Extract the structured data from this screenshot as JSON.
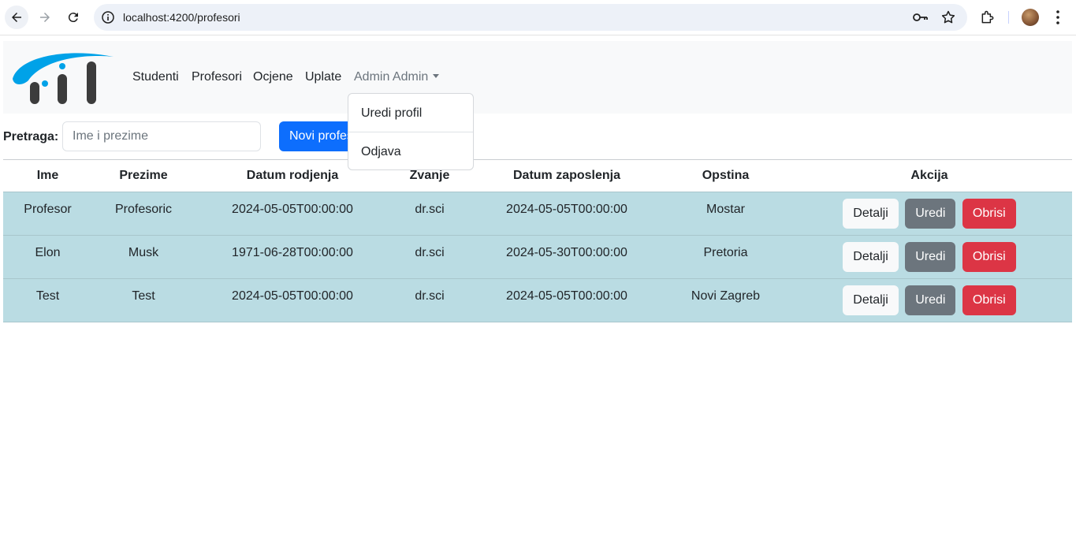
{
  "browser": {
    "url": "localhost:4200/profesori",
    "icons": [
      "back-arrow-icon",
      "forward-arrow-icon",
      "reload-icon",
      "site-info-icon",
      "password-key-icon",
      "bookmark-star-icon",
      "extensions-puzzle-icon",
      "profile-avatar",
      "menu-kebab-icon"
    ]
  },
  "navbar": {
    "items": [
      {
        "label": "Studenti"
      },
      {
        "label": "Profesori"
      },
      {
        "label": "Ocjene"
      },
      {
        "label": "Uplate"
      }
    ],
    "user_label": "Admin Admin",
    "dropdown": {
      "items": [
        {
          "label": "Uredi profil"
        },
        {
          "label": "Odjava"
        }
      ]
    }
  },
  "search": {
    "label": "Pretraga:",
    "placeholder": "Ime i prezime",
    "value": "",
    "new_button_label": "Novi profesor"
  },
  "table": {
    "headers": [
      "Ime",
      "Prezime",
      "Datum rodjenja",
      "Zvanje",
      "Datum zaposlenja",
      "Opstina",
      "Akcija"
    ],
    "rows": [
      {
        "ime": "Profesor",
        "prezime": "Profesoric",
        "datum_rodjenja": "2024-05-05T00:00:00",
        "zvanje": "dr.sci",
        "datum_zaposlenja": "2024-05-05T00:00:00",
        "opstina": "Mostar"
      },
      {
        "ime": "Elon",
        "prezime": "Musk",
        "datum_rodjenja": "1971-06-28T00:00:00",
        "zvanje": "dr.sci",
        "datum_zaposlenja": "2024-05-30T00:00:00",
        "opstina": "Pretoria"
      },
      {
        "ime": "Test",
        "prezime": "Test",
        "datum_rodjenja": "2024-05-05T00:00:00",
        "zvanje": "dr.sci",
        "datum_zaposlenja": "2024-05-05T00:00:00",
        "opstina": "Novi Zagreb"
      }
    ],
    "actions": {
      "details": "Detalji",
      "edit": "Uredi",
      "delete": "Obrisi"
    }
  },
  "colors": {
    "primary": "#0d6efd",
    "secondary": "#6c757d",
    "danger": "#dc3545",
    "row_bg": "#badce3",
    "logo_blue": "#00a2e8",
    "logo_dark": "#3c3c3c"
  }
}
